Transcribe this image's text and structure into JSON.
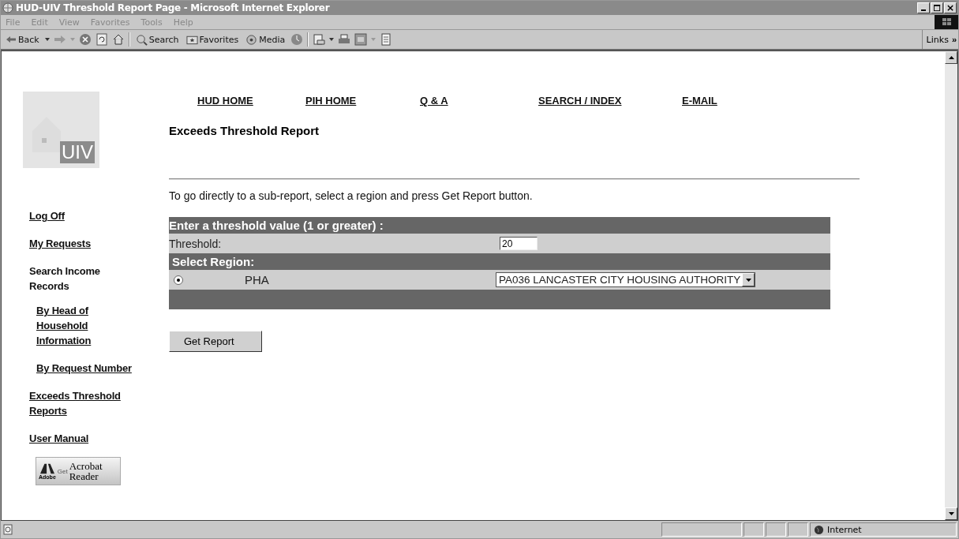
{
  "window": {
    "title": "HUD-UIV Threshold Report Page - Microsoft Internet Explorer"
  },
  "menu": [
    "File",
    "Edit",
    "View",
    "Favorites",
    "Tools",
    "Help"
  ],
  "toolbar": {
    "back": "Back",
    "search": "Search",
    "favorites": "Favorites",
    "media": "Media",
    "links": "Links",
    "more": "»"
  },
  "logo": {
    "text": "UIV"
  },
  "nav": [
    "HUD HOME",
    "PIH HOME",
    "Q & A",
    "SEARCH / INDEX",
    "E-MAIL"
  ],
  "heading": "Exceeds Threshold Report",
  "instruction": "To go directly to a sub-report, select a region and press Get Report button.",
  "sidebar": [
    {
      "kind": "link",
      "label": "Log Off"
    },
    {
      "kind": "link",
      "label": "My Requests"
    },
    {
      "kind": "heading",
      "label": "Search Income Records",
      "children": [
        {
          "kind": "link",
          "label": "By Head of Household Information"
        },
        {
          "kind": "link",
          "label": "By Request Number"
        }
      ]
    },
    {
      "kind": "link",
      "label": "Exceeds Threshold Reports"
    },
    {
      "kind": "link",
      "label": "User Manual"
    }
  ],
  "acrobat": {
    "brand": "Adobe",
    "get": "Get",
    "product": "Acrobat",
    "product2": "Reader"
  },
  "form": {
    "threshold_header": "Enter a threshold value (1 or greater) :",
    "threshold_label": "Threshold:",
    "threshold_value": "20",
    "region_header": "Select Region:",
    "regions": [
      {
        "label": "PHA",
        "selected": true,
        "value": "PA036 LANCASTER CITY HOUSING AUTHORITY"
      }
    ]
  },
  "button": "Get Report",
  "status_bar": {
    "zone": "Internet"
  }
}
